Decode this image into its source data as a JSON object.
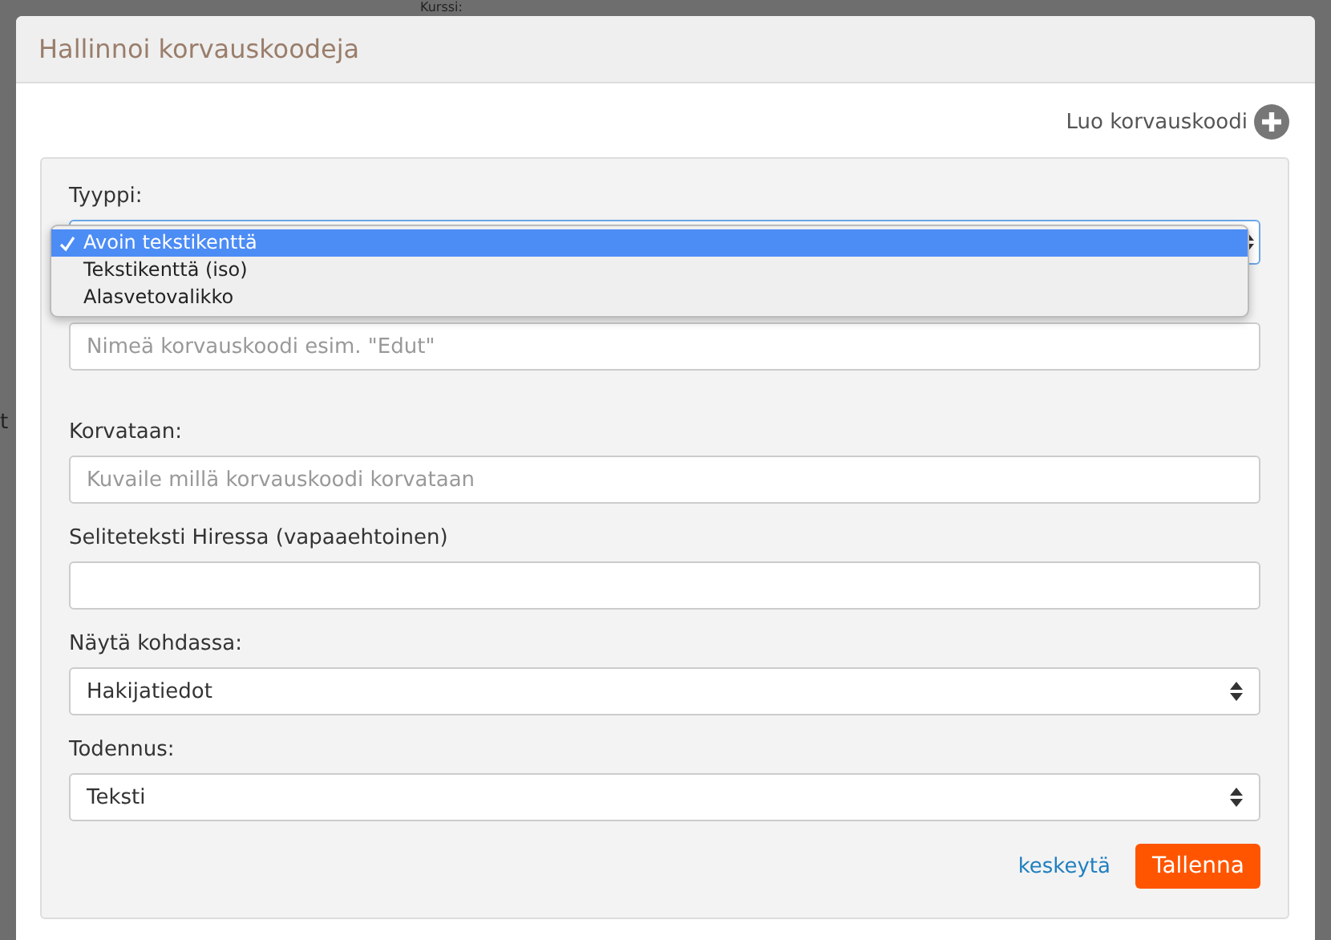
{
  "background": {
    "heading": "Kurssi:",
    "side_text": "t"
  },
  "dialog": {
    "title": "Hallinnoi korvauskoodeja",
    "create_link": "Luo korvauskoodi"
  },
  "type_field": {
    "label": "Tyyppi:",
    "options": [
      {
        "label": "Avoin tekstikenttä",
        "selected": true
      },
      {
        "label": "Tekstikenttä (iso)",
        "selected": false
      },
      {
        "label": "Alasvetovalikko",
        "selected": false
      }
    ]
  },
  "fields": [
    {
      "kind": "input",
      "placeholder": "Nimeä korvauskoodi esim. \"Edut\""
    },
    {
      "kind": "input",
      "label": "Korvataan:",
      "placeholder": "Kuvaile millä korvauskoodi korvataan"
    },
    {
      "kind": "input",
      "label": "Seliteteksti Hiressa (vapaaehtoinen)"
    },
    {
      "kind": "select",
      "label": "Näytä kohdassa:",
      "value": "Hakijatiedot"
    },
    {
      "kind": "select",
      "label": "Todennus:",
      "value": "Teksti"
    }
  ],
  "actions": {
    "cancel": "keskeytä",
    "save": "Tallenna"
  }
}
